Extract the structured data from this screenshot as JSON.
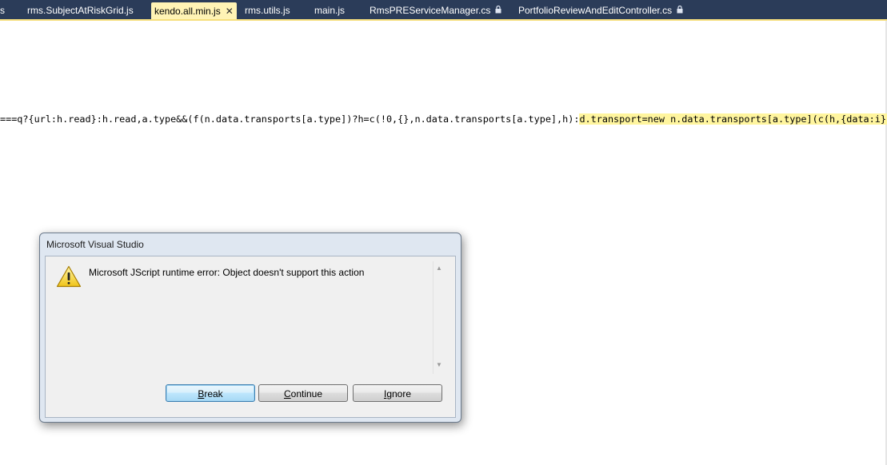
{
  "tabs": [
    {
      "label": "s",
      "active": false,
      "locked": false
    },
    {
      "label": "rms.SubjectAtRiskGrid.js",
      "active": false,
      "locked": false
    },
    {
      "label": "kendo.all.min.js",
      "active": true,
      "locked": false
    },
    {
      "label": "rms.utils.js",
      "active": false,
      "locked": false
    },
    {
      "label": "main.js",
      "active": false,
      "locked": false
    },
    {
      "label": "RmsPREServiceManager.cs",
      "active": false,
      "locked": true
    },
    {
      "label": "PortfolioReviewAndEditController.cs",
      "active": false,
      "locked": true
    }
  ],
  "close_glyph": "✕",
  "lock_icon": "lock-icon",
  "code": {
    "before": "===q?{url:h.read}:h.read,a.type&&(f(n.data.transports[a.type])?h=c(!0,{},n.data.transports[a.type],h):",
    "highlighted": "d.transport=new n.data.transports[a.type](c(h,{data:i}))",
    "after": ","
  },
  "dialog": {
    "title": "Microsoft Visual Studio",
    "message": "Microsoft JScript runtime error: Object doesn't support this action",
    "icon": "warning-icon",
    "buttons": {
      "break": {
        "mnemonic": "B",
        "rest": "reak"
      },
      "continue": {
        "mnemonic": "C",
        "rest": "ontinue"
      },
      "ignore": {
        "mnemonic": "I",
        "rest": "gnore"
      }
    }
  },
  "colors": {
    "tabstrip_bg": "#2b3c59",
    "active_tab": "#fff3b5",
    "highlight": "#fff59e",
    "warning_yellow": "#f5d229"
  }
}
